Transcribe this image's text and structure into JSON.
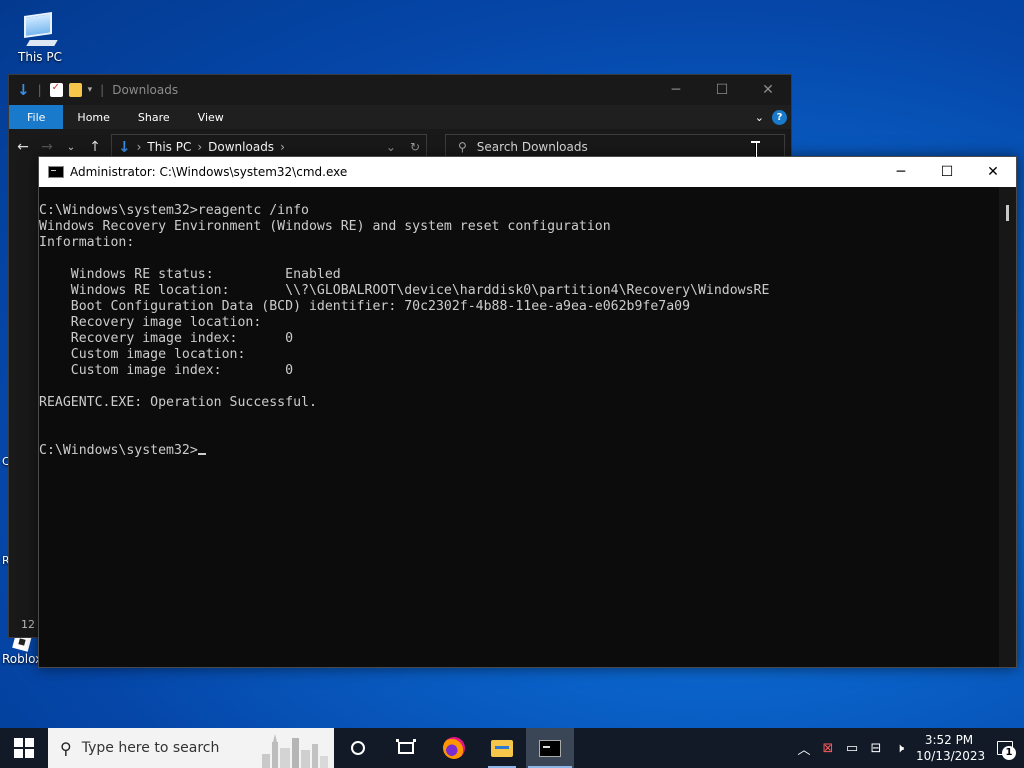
{
  "desktop": {
    "this_pc_label": "This PC",
    "roblox_label": "Roblox",
    "edge_letters": [
      "C",
      "R"
    ]
  },
  "explorer": {
    "title": "Downloads",
    "title_separator": "|",
    "tabs": [
      "File",
      "Home",
      "Share",
      "View"
    ],
    "breadcrumb": [
      "This PC",
      "Downloads"
    ],
    "search_placeholder": "Search Downloads",
    "status_count": "12",
    "colors": {
      "accent": "#1979ca",
      "background": "#191919"
    }
  },
  "cmd": {
    "title": "Administrator: C:\\Windows\\system32\\cmd.exe",
    "lines": [
      "C:\\Windows\\system32>reagentc /info",
      "Windows Recovery Environment (Windows RE) and system reset configuration",
      "Information:",
      "",
      "    Windows RE status:         Enabled",
      "    Windows RE location:       \\\\?\\GLOBALROOT\\device\\harddisk0\\partition4\\Recovery\\WindowsRE",
      "    Boot Configuration Data (BCD) identifier: 70c2302f-4b88-11ee-a9ea-e062b9fe7a09",
      "    Recovery image location:",
      "    Recovery image index:      0",
      "    Custom image location:",
      "    Custom image index:        0",
      "",
      "REAGENTC.EXE: Operation Successful.",
      "",
      ""
    ],
    "prompt": "C:\\Windows\\system32>",
    "colors": {
      "background": "#0c0c0c",
      "text": "#cccccc"
    }
  },
  "taskbar": {
    "search_placeholder": "Type here to search",
    "clock_time": "3:52 PM",
    "clock_date": "10/13/2023",
    "notification_count": "1",
    "colors": {
      "background": "#111a26",
      "active_indicator": "#8cb7e8"
    }
  }
}
